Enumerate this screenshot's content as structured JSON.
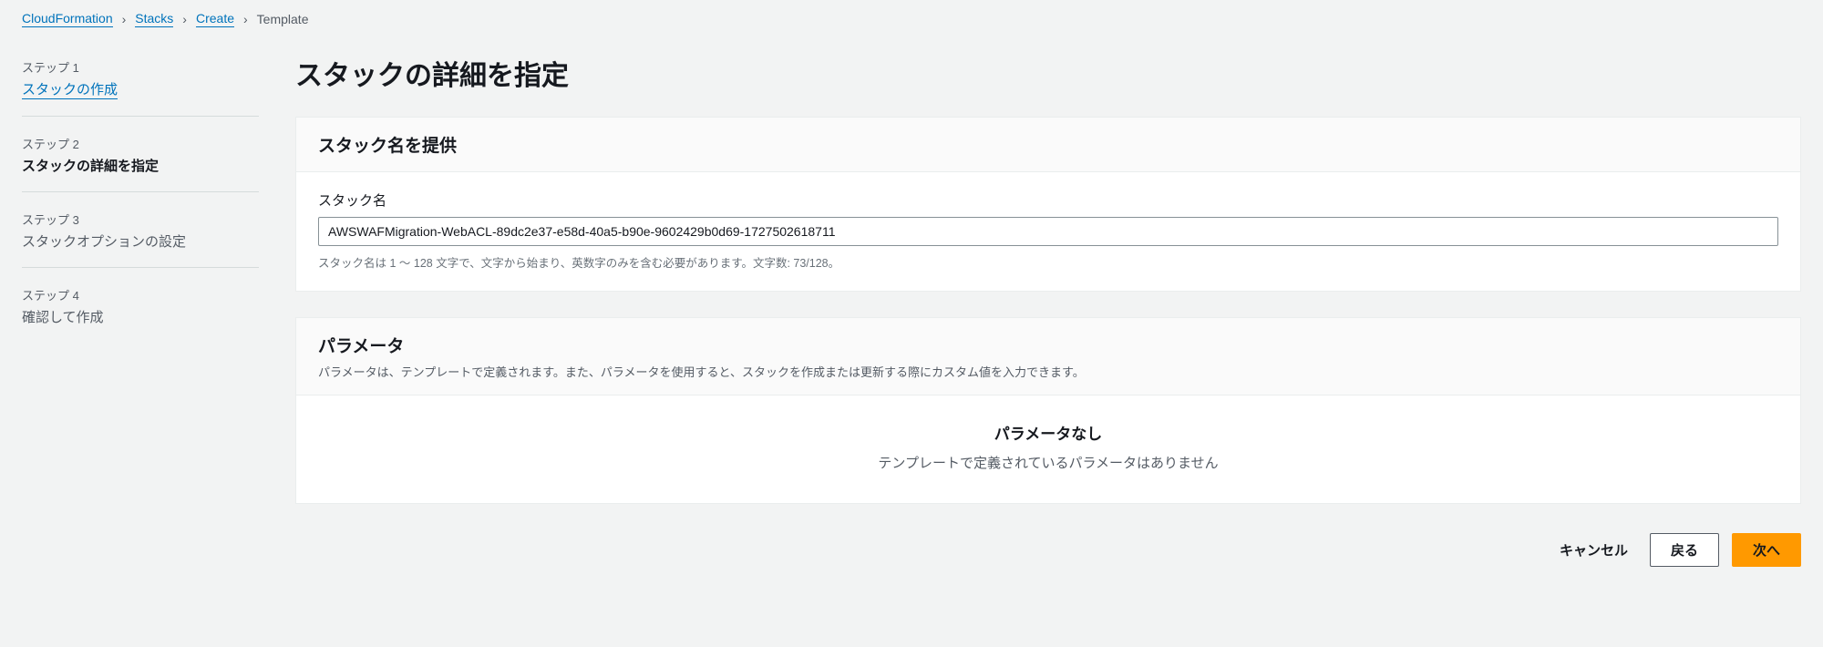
{
  "breadcrumb": {
    "items": [
      {
        "label": "CloudFormation",
        "link": true
      },
      {
        "label": "Stacks",
        "link": true
      },
      {
        "label": "Create",
        "link": true
      },
      {
        "label": "Template",
        "link": false
      }
    ]
  },
  "wizard": {
    "steps": [
      {
        "label": "ステップ 1",
        "title": "スタックの作成",
        "state": "link"
      },
      {
        "label": "ステップ 2",
        "title": "スタックの詳細を指定",
        "state": "active"
      },
      {
        "label": "ステップ 3",
        "title": "スタックオプションの設定",
        "state": "pending"
      },
      {
        "label": "ステップ 4",
        "title": "確認して作成",
        "state": "pending"
      }
    ]
  },
  "page": {
    "title": "スタックの詳細を指定"
  },
  "stack_name_panel": {
    "heading": "スタック名を提供",
    "field_label": "スタック名",
    "value": "AWSWAFMigration-WebACL-89dc2e37-e58d-40a5-b90e-9602429b0d69-1727502618711",
    "hint": "スタック名は 1 ～ 128 文字で、文字から始まり、英数字のみを含む必要があります。文字数: 73/128。"
  },
  "parameters_panel": {
    "heading": "パラメータ",
    "description": "パラメータは、テンプレートで定義されます。また、パラメータを使用すると、スタックを作成または更新する際にカスタム値を入力できます。",
    "empty_title": "パラメータなし",
    "empty_subtitle": "テンプレートで定義されているパラメータはありません"
  },
  "footer": {
    "cancel": "キャンセル",
    "back": "戻る",
    "next": "次へ"
  }
}
